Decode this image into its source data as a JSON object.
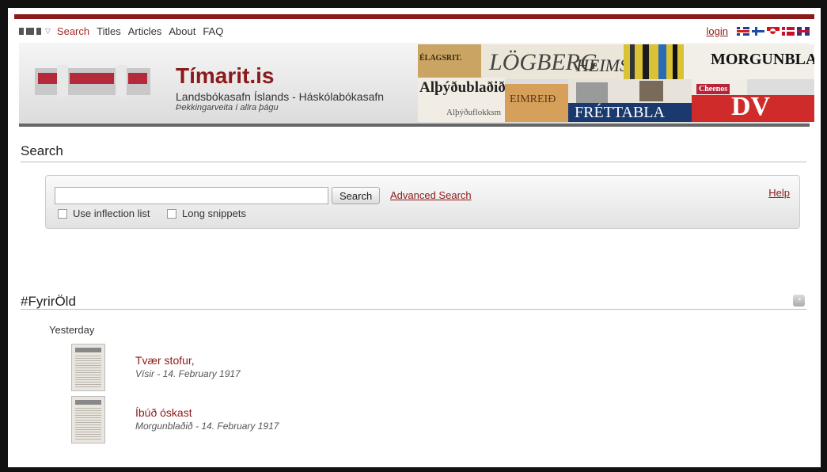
{
  "topnav": {
    "logo_icon": "timarit-logo-icon",
    "links": [
      {
        "label": "Search",
        "active": true
      },
      {
        "label": "Titles"
      },
      {
        "label": "Articles"
      },
      {
        "label": "About"
      },
      {
        "label": "FAQ"
      }
    ],
    "login_label": "login",
    "flags": [
      "is",
      "fi",
      "gl",
      "dk",
      "uk"
    ],
    "accent_color": "#8b1a1a"
  },
  "banner": {
    "title": "Tímarit.is",
    "subtitle": "Landsbókasafn Íslands - Háskólabókasafn",
    "tagline": "Þekkingarveita í allra þágu",
    "collage_texts": [
      "ÉLAGSRIT.",
      "LÖGBERG",
      "HEIMSKR",
      "MORGUNBLA",
      "Alþýðublaðið",
      "EIMREIÐ",
      "FRÉTTABLA",
      "DV",
      "Alþýðuflokksm",
      "Cheenos"
    ]
  },
  "search": {
    "section_title": "Search",
    "input_value": "",
    "button_label": "Search",
    "advanced_label": "Advanced Search",
    "help_label": "Help",
    "option_inflection": "Use inflection list",
    "option_snippets": "Long snippets"
  },
  "feed": {
    "section_title": "#FyrirÖld",
    "day_label": "Yesterday",
    "items": [
      {
        "title": "Tvær stofur,",
        "meta": "Vísir - 14. February 1917"
      },
      {
        "title": "Íbúð óskast",
        "meta": "Morgunblaðið - 14. February 1917"
      }
    ]
  }
}
